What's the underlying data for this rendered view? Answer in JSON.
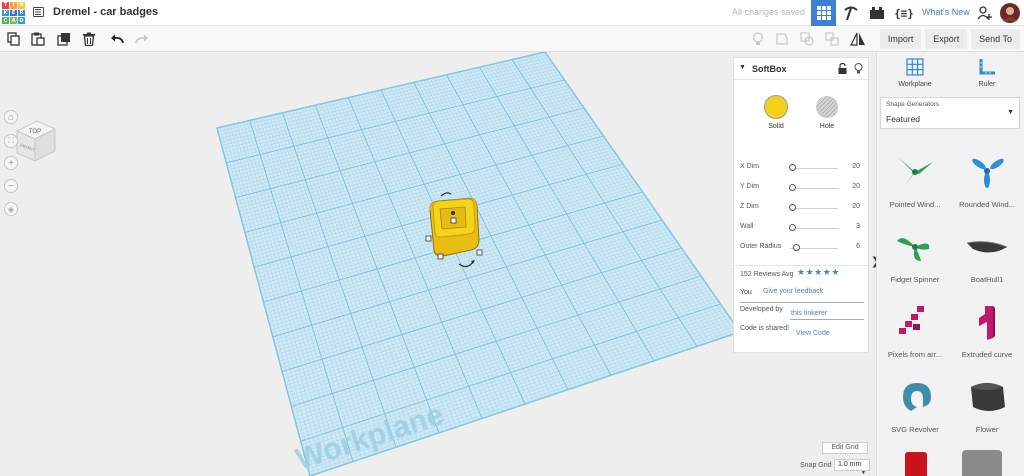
{
  "app": {
    "logo_letters": [
      "T",
      "I",
      "N",
      "K",
      "E",
      "R",
      "C",
      "A",
      "D"
    ],
    "logo_colors": [
      "#e9443f",
      "#f2a33a",
      "#f6c633",
      "#2f9ad9",
      "#3e6fd2",
      "#2e8bd0",
      "#49b66a",
      "#6cc15e",
      "#2f9ad9"
    ]
  },
  "header": {
    "title": "Dremel - car badges",
    "save_status": "All changes saved",
    "whats_new": "What's New"
  },
  "actions": {
    "import": "Import",
    "export": "Export",
    "send_to": "Send To"
  },
  "viewcube": {
    "top": "TOP",
    "front": "FRONT"
  },
  "workplane_label": "Workplane",
  "inspector": {
    "shape_name": "SoftBox",
    "solid_label": "Solid",
    "hole_label": "Hole",
    "solid_color": "#f6d21a",
    "params": [
      {
        "label": "X Dim",
        "value": "20",
        "level": 0.05
      },
      {
        "label": "Y Dim",
        "value": "20",
        "level": 0.05
      },
      {
        "label": "Z Dim",
        "value": "20",
        "level": 0.05
      },
      {
        "label": "Wall",
        "value": "3",
        "level": 0.05
      },
      {
        "label": "Outer Radius",
        "value": "6",
        "level": 0.12
      }
    ],
    "reviews_text": "152 Reviews Avg",
    "rating_stars": 5,
    "you_label": "You",
    "feedback_link": "Give your feedback",
    "developed_by_label": "Developed by",
    "developer_link": "this tinkerer",
    "code_shared_label": "Code is shared!",
    "view_code_link": "View Code"
  },
  "right_panel": {
    "workplane_label": "Workplane",
    "ruler_label": "Ruler",
    "generators_label": "Shape Generators",
    "generators_value": "Featured",
    "shapes": [
      {
        "name": "Pointed Wind...",
        "icon": "pointed-windmill-icon"
      },
      {
        "name": "Rounded Wind...",
        "icon": "rounded-windmill-icon"
      },
      {
        "name": "Fidget Spinner",
        "icon": "fidget-spinner-icon"
      },
      {
        "name": "BoatHull1",
        "icon": "boathull-icon"
      },
      {
        "name": "Pixels from arr...",
        "icon": "pixels-icon"
      },
      {
        "name": "Extruded curve",
        "icon": "extruded-curve-icon"
      },
      {
        "name": "SVG Revolver",
        "icon": "svg-revolver-icon"
      },
      {
        "name": "Flower",
        "icon": "flower-icon"
      }
    ]
  },
  "grid": {
    "edit_grid": "Edit Grid",
    "snap_label": "Snap Grid",
    "snap_value": "1.0 mm"
  }
}
